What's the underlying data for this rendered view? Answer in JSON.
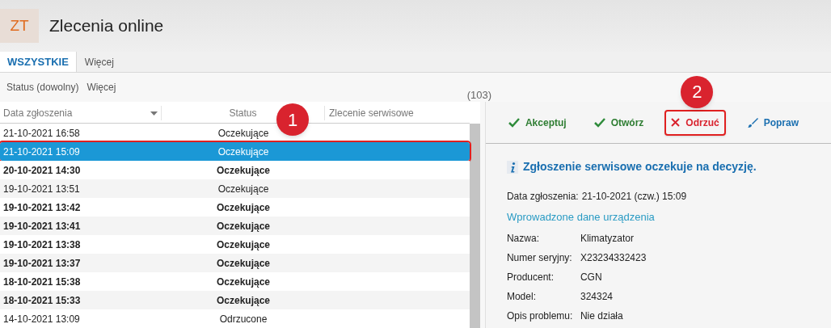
{
  "app": {
    "logo": "ZT",
    "title": "Zlecenia online"
  },
  "tabs": [
    {
      "label": "WSZYSTKIE",
      "selected": true
    },
    {
      "label": "Więcej",
      "selected": false
    }
  ],
  "filters": [
    "Status (dowolny)",
    "Więcej"
  ],
  "count": "(103)",
  "table": {
    "columns": [
      "Data zgłoszenia",
      "Status",
      "Zlecenie serwisowe"
    ],
    "rows": [
      {
        "date": "21-10-2021  16:58",
        "status": "Oczekujące",
        "unread": false,
        "selected": false
      },
      {
        "date": "21-10-2021  15:09",
        "status": "Oczekujące",
        "unread": false,
        "selected": true,
        "marker": "1"
      },
      {
        "date": "20-10-2021  14:30",
        "status": "Oczekujące",
        "unread": true,
        "selected": false
      },
      {
        "date": "19-10-2021  13:51",
        "status": "Oczekujące",
        "unread": false,
        "selected": false
      },
      {
        "date": "19-10-2021  13:42",
        "status": "Oczekujące",
        "unread": true,
        "selected": false
      },
      {
        "date": "19-10-2021  13:41",
        "status": "Oczekujące",
        "unread": true,
        "selected": false
      },
      {
        "date": "19-10-2021  13:38",
        "status": "Oczekujące",
        "unread": true,
        "selected": false
      },
      {
        "date": "19-10-2021  13:37",
        "status": "Oczekujące",
        "unread": true,
        "selected": false
      },
      {
        "date": "18-10-2021  15:38",
        "status": "Oczekujące",
        "unread": true,
        "selected": false
      },
      {
        "date": "18-10-2021  15:33",
        "status": "Oczekujące",
        "unread": true,
        "selected": false
      },
      {
        "date": "14-10-2021  13:09",
        "status": "Odrzucone",
        "unread": false,
        "selected": false
      }
    ]
  },
  "toolbar": [
    {
      "label": "Akceptuj",
      "kind": "accept",
      "highlighted": false
    },
    {
      "label": "Otwórz",
      "kind": "accept",
      "highlighted": false
    },
    {
      "label": "Odrzuć",
      "kind": "reject",
      "highlighted": true,
      "marker": "2"
    },
    {
      "label": "Popraw",
      "kind": "edit",
      "highlighted": false
    }
  ],
  "detail": {
    "notice": "Zgłoszenie serwisowe oczekuje na decyzję.",
    "date": {
      "label": "Data zgłoszenia:",
      "value": "21-10-2021 (czw.) 15:09"
    },
    "section": "Wprowadzone dane urządzenia",
    "fields": [
      {
        "label": "Nazwa:",
        "value": "Klimatyzator"
      },
      {
        "label": "Numer seryjny:",
        "value": "X23234332423"
      },
      {
        "label": "Producent:",
        "value": "CGN"
      },
      {
        "label": "Model:",
        "value": "324324"
      },
      {
        "label": "Opis problemu:",
        "value": "Nie działa"
      }
    ]
  }
}
